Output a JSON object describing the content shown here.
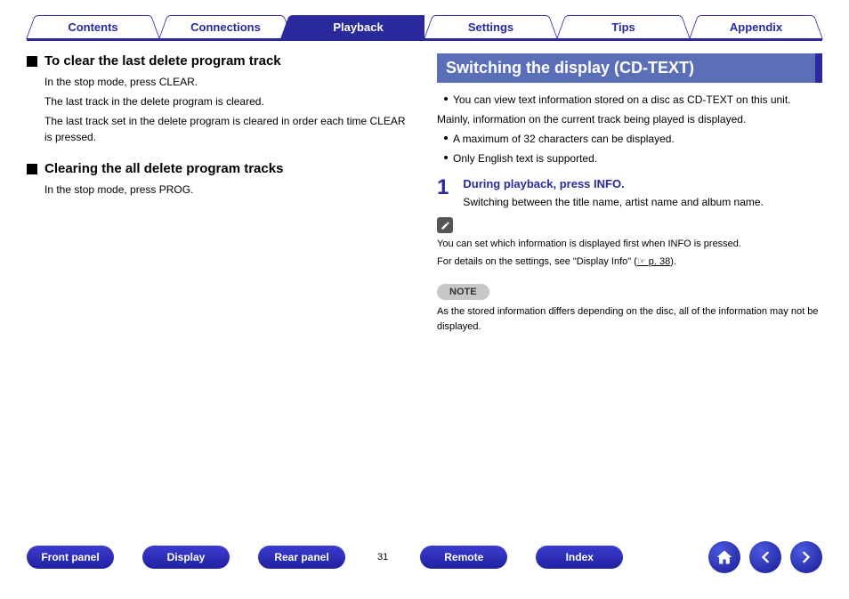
{
  "tabs": {
    "contents": "Contents",
    "connections": "Connections",
    "playback": "Playback",
    "settings": "Settings",
    "tips": "Tips",
    "appendix": "Appendix"
  },
  "left": {
    "heading1": "To clear the last delete program track",
    "p1": "In the stop mode, press CLEAR.",
    "p2": "The last track in the delete program is cleared.",
    "p3": "The last track set in the delete program is cleared in order each time CLEAR is pressed.",
    "heading2": "Clearing the all delete program tracks",
    "p4": "In the stop mode, press PROG."
  },
  "right": {
    "title": "Switching the display (CD-TEXT)",
    "b1": "You can view text information stored on a disc as CD-TEXT on this unit.",
    "p1": "Mainly, information on the current track being played is displayed.",
    "b2": "A maximum of 32 characters can be displayed.",
    "b3": "Only English text is supported.",
    "step_num": "1",
    "step_title": "During playback, press INFO.",
    "step_body": "Switching between the title name, artist name and album name.",
    "tip1": "You can set which information is displayed first when INFO is pressed.",
    "tip2_pre": "For details on the settings, see \"Display Info\" (",
    "tip2_link": "☞ p. 38",
    "tip2_post": ").",
    "note_label": "NOTE",
    "note_body": "As the stored information differs depending on the disc, all of the information may not be displayed."
  },
  "footer": {
    "front_panel": "Front panel",
    "display": "Display",
    "rear_panel": "Rear panel",
    "page": "31",
    "remote": "Remote",
    "index": "Index"
  }
}
